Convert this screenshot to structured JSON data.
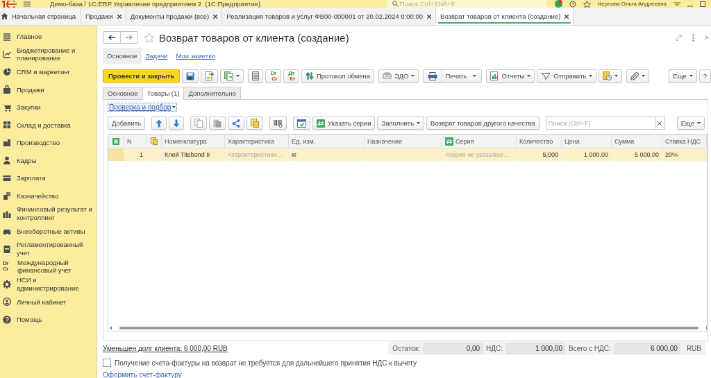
{
  "title_bar": {
    "title": "Демо-база / 1С:ERP Управление предприятием 2  (1С:Предприятие)",
    "search": {
      "placeholder": "Поиск Ctrl+Shift+F"
    },
    "user": "Чернова Ольга Андреевна"
  },
  "open_tabs": [
    {
      "label": "Начальная страница",
      "kind": "home",
      "selected": false
    },
    {
      "label": "Продажи",
      "kind": "closable",
      "selected": false
    },
    {
      "label": "Документы продажи (все)",
      "kind": "closable",
      "selected": false
    },
    {
      "label": "Реализация товаров и услуг ФВ00-000001 от 20.02.2024 0:00:00",
      "kind": "closable",
      "selected": false
    },
    {
      "label": "Возврат товаров от клиента (создание)",
      "kind": "closable",
      "selected": true
    }
  ],
  "sidebar": {
    "items": [
      {
        "label": "Главное"
      },
      {
        "label": "Бюджетирование и планирование"
      },
      {
        "label": "CRM и маркетинг"
      },
      {
        "label": "Продажи"
      },
      {
        "label": "Закупки"
      },
      {
        "label": "Склад и доставка"
      },
      {
        "label": "Производство"
      },
      {
        "label": "Кадры"
      },
      {
        "label": "Зарплата"
      },
      {
        "label": "Казначейство"
      },
      {
        "label": "Финансовый результат и контроллинг"
      },
      {
        "label": "Внеоборотные активы"
      },
      {
        "label": "Регламентированный учет"
      },
      {
        "label": "Международный финансовый учет",
        "icon_text": [
          "Dr",
          "Cr"
        ]
      },
      {
        "label": "НСИ и администрирование"
      },
      {
        "label": "Личный кабинет"
      },
      {
        "label": "Помощь"
      }
    ]
  },
  "form": {
    "title": "Возврат товаров от клиента (создание)",
    "sections": [
      {
        "label": "Основное",
        "selected": true
      },
      {
        "label": "Задачи",
        "selected": false
      },
      {
        "label": "Мои заметки",
        "selected": false
      }
    ],
    "command_groups": [
      [
        {
          "kind": "primary",
          "label": "Провести и закрыть",
          "dropdown": false
        },
        {
          "kind": "icon",
          "dropdown": false
        },
        {
          "kind": "icon",
          "dropdown": false
        },
        {
          "kind": "icon",
          "dropdown": true
        }
      ],
      [
        {
          "kind": "icon",
          "dropdown": false
        },
        {
          "kind": "dtkt",
          "icon_text": [
            "Dr",
            "Cr"
          ],
          "dropdown": false
        },
        {
          "kind": "dtkt",
          "icon_text": [
            "Дт",
            "Кт"
          ],
          "dropdown": false
        },
        {
          "kind": "labeled",
          "label": "Протокол обмена",
          "dropdown": false
        }
      ],
      [
        {
          "kind": "labeled",
          "label": "ЭДО",
          "dropdown": true
        }
      ],
      [
        {
          "kind": "split",
          "label": "Печать",
          "dropdown": true
        }
      ],
      [
        {
          "kind": "labeled",
          "label": "Отчеты",
          "dropdown": true
        },
        {
          "kind": "labeled",
          "label": "Отправить",
          "dropdown": true
        },
        {
          "kind": "icon",
          "dropdown": true
        }
      ],
      [
        {
          "kind": "icon",
          "dropdown": true
        }
      ],
      [
        {
          "kind": "text",
          "label": "Еще",
          "dropdown": true
        },
        {
          "kind": "text",
          "label": "?"
        }
      ]
    ],
    "pages": [
      {
        "label": "Основное",
        "selected": false
      },
      {
        "label": "Товары (1)",
        "selected": true
      },
      {
        "label": "Дополнительно",
        "selected": false
      }
    ],
    "check_link": "Проверка и подбор",
    "table_toolbar": [
      [
        {
          "kind": "text",
          "label": "Добавить",
          "dropdown": false
        }
      ],
      [
        {
          "kind": "icon",
          "dropdown": false
        },
        {
          "kind": "icon",
          "dropdown": false
        }
      ],
      [
        {
          "kind": "icon",
          "dropdown": false
        },
        {
          "kind": "icon",
          "dropdown": false
        },
        {
          "kind": "icon",
          "dropdown": false
        },
        {
          "kind": "icon",
          "dropdown": false
        }
      ],
      [
        {
          "kind": "icon",
          "dropdown": false
        }
      ],
      [
        {
          "kind": "icon",
          "dropdown": false
        },
        {
          "kind": "labeled",
          "label": "Указать серии",
          "dropdown": false
        },
        {
          "kind": "text",
          "label": "Заполнить",
          "dropdown": true
        },
        {
          "kind": "text",
          "label": "Возврат товаров другого качества",
          "dropdown": false
        }
      ]
    ],
    "table_search": {
      "placeholder": "Поиск (Ctrl+F)"
    },
    "table_more": {
      "label": "Еще",
      "dropdown": true
    },
    "table": {
      "columns": [
        {
          "label": "N",
          "kind": "number"
        },
        {
          "label": "Номенклатура",
          "kind": "text"
        },
        {
          "label": "Характеристика",
          "kind": "text"
        },
        {
          "label": "Ед. изм.",
          "kind": "text"
        },
        {
          "label": "Назначение",
          "kind": "text"
        },
        {
          "label": "Серия",
          "kind": "series"
        },
        {
          "label": "Количество",
          "kind": "number"
        },
        {
          "label": "Цена",
          "kind": "number"
        },
        {
          "label": "Сумма",
          "kind": "number"
        },
        {
          "label": "Ставка НДС",
          "kind": "text"
        }
      ],
      "rows": [
        {
          "selected": true,
          "cells": [
            {
              "kind": "value",
              "text": "1"
            },
            {
              "kind": "value",
              "text": "Клей Titebond II"
            },
            {
              "kind": "placeholder",
              "text": "<характеристики…"
            },
            {
              "kind": "value",
              "text": "кг"
            },
            {
              "kind": "empty"
            },
            {
              "kind": "placeholder",
              "text": "<серия не указывае…"
            },
            {
              "kind": "value",
              "text": "5,000"
            },
            {
              "kind": "value",
              "text": "1 000,00"
            },
            {
              "kind": "value",
              "text": "5 000,00"
            },
            {
              "kind": "value",
              "text": "20%"
            }
          ]
        }
      ]
    },
    "debt_link": "Уменьшен долг клиента: 6 000,00 RUB",
    "totals": [
      {
        "label": "Остаток:",
        "value": "0,00"
      },
      {
        "label": "НДС:",
        "value": "1 000,00"
      },
      {
        "label": "Всего с НДС:",
        "value": "6 000,00"
      }
    ],
    "currency": "RUB",
    "invoice_not_required": {
      "label": "Получение счета-фактуры на возврат не требуется для дальнейшего принятия НДС к вычету",
      "checked": false
    },
    "invoice_link": "Оформить счет-фактуру"
  }
}
